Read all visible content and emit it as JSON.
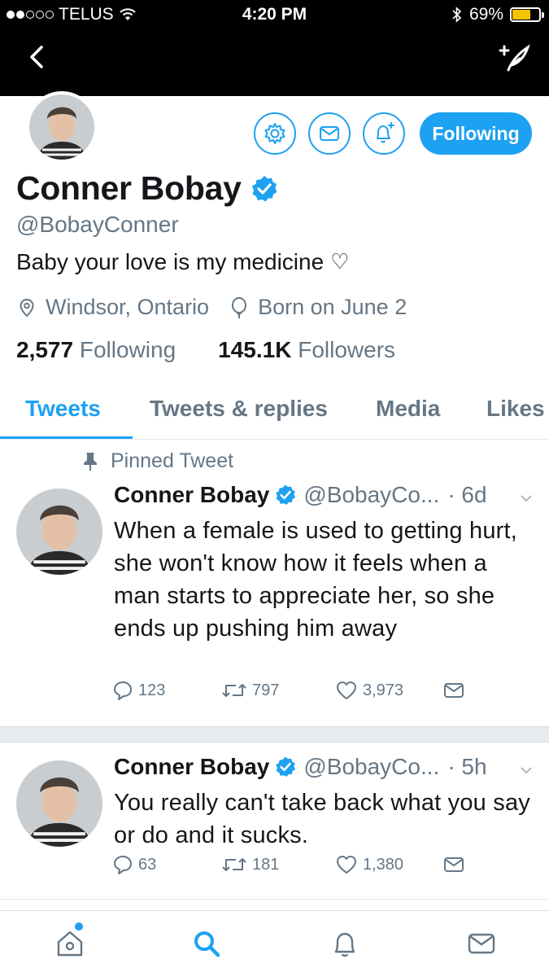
{
  "status_bar": {
    "carrier": "TELUS",
    "time": "4:20 PM",
    "battery": "69%",
    "battery_level": 0.69
  },
  "nav": {
    "back_icon": "chevron-left-icon",
    "compose_icon": "compose-tweet-icon"
  },
  "profile": {
    "name": "Conner Bobay",
    "verified": true,
    "handle": "@BobayConner",
    "bio": "Baby your love is my medicine",
    "bio_emoji": "♡",
    "location": "Windsor, Ontario",
    "birthday": "Born on June 2",
    "following_count": "2,577",
    "following_label": "Following",
    "followers_count": "145.1K",
    "followers_label": "Followers",
    "follow_button": "Following"
  },
  "tabs": [
    {
      "label": "Tweets",
      "active": true
    },
    {
      "label": "Tweets & replies",
      "active": false
    },
    {
      "label": "Media",
      "active": false
    },
    {
      "label": "Likes",
      "active": false
    }
  ],
  "tweets": [
    {
      "pinned_label": "Pinned Tweet",
      "name": "Conner Bobay",
      "handle": "@BobayCo...",
      "time": "· 6d",
      "text": "When a female is used to getting hurt, she won't know how it feels when a man starts to appreciate her, so she ends up pushing him away",
      "replies": "123",
      "retweets": "797",
      "likes": "3,973"
    },
    {
      "name": "Conner Bobay",
      "handle": "@BobayCo...",
      "time": "· 5h",
      "text": "You really can't take back what you say or do and it sucks.",
      "replies": "63",
      "retweets": "181",
      "likes": "1,380"
    }
  ],
  "colors": {
    "accent": "#1da1f2",
    "text_primary": "#14171a",
    "text_secondary": "#657786",
    "battery": "#f5c400"
  }
}
